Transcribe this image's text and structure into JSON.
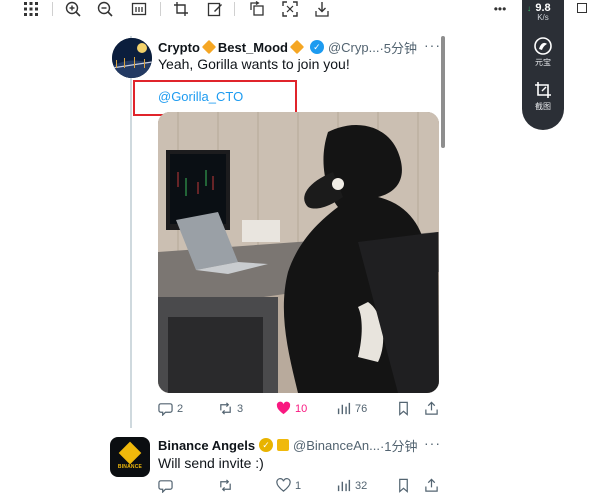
{
  "toolbar": {
    "icons": [
      "grid-icon",
      "zoom-in-icon",
      "zoom-out-icon",
      "fit-width-icon",
      "crop-icon",
      "edit-icon",
      "rotate-icon",
      "fullscreen-icon",
      "download-icon",
      "more-icon"
    ],
    "more_label": "•••"
  },
  "widget": {
    "speed": "9.8",
    "speed_unit": "K/s",
    "item1_label": "元宝",
    "item2_label": "截图"
  },
  "tweet1": {
    "name": "Crypto",
    "name_suffix": "Best_Mood",
    "handle": "@Cryp...",
    "time": "·5分钟",
    "text": "Yeah, Gorilla wants to join you!",
    "mention": "@Gorilla_CTO",
    "replies": "2",
    "retweets": "3",
    "likes": "10",
    "views": "76"
  },
  "tweet2": {
    "name": "Binance Angels",
    "handle": "@BinanceAn...",
    "time": "·1分钟",
    "text": "Will send invite :)",
    "avatar_text": "BINANCE",
    "replies": "",
    "retweets": "",
    "likes": "1",
    "views": "32"
  },
  "more_menu_label": "···",
  "colors": {
    "accent_blue": "#1d9bf0",
    "like_pink": "#f91880",
    "highlight_red": "#e0242b",
    "binance_yellow": "#f0b90b"
  }
}
